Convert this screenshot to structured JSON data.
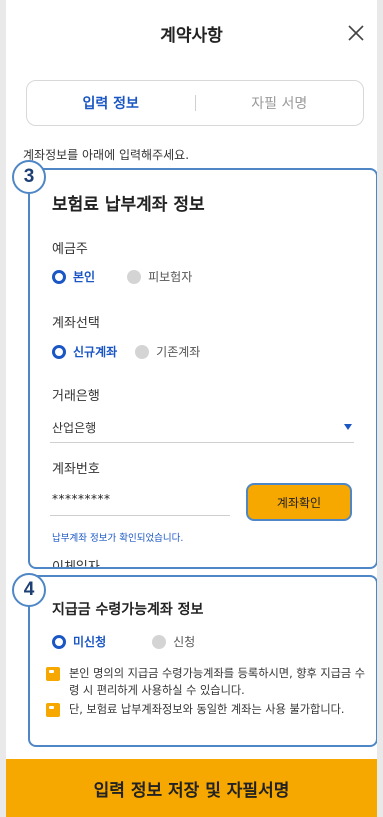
{
  "header": {
    "title": "계약사항"
  },
  "tabs": [
    {
      "label": "입력 정보",
      "active": true
    },
    {
      "label": "자필 서명",
      "active": false
    }
  ],
  "intro": "계좌정보를 아래에 입력해주세요.",
  "section1": {
    "step": "3",
    "title": "보험료 납부계좌 정보",
    "depositor": {
      "label": "예금주",
      "options": [
        {
          "label": "본인",
          "selected": true
        },
        {
          "label": "피보험자",
          "selected": false
        }
      ]
    },
    "account_select": {
      "label": "계좌선택",
      "options": [
        {
          "label": "신규계좌",
          "selected": true
        },
        {
          "label": "기존계좌",
          "selected": false
        }
      ]
    },
    "bank": {
      "label": "거래은행",
      "value": "산업은행"
    },
    "account_number": {
      "label": "계좌번호",
      "value": "*********",
      "button": "계좌확인"
    },
    "confirm_message": "납부계좌 정보가 확인되었습니다.",
    "next_label_cut": "이체일자"
  },
  "section2": {
    "step": "4",
    "title": "지급금 수령가능계좌 정보",
    "options": [
      {
        "label": "미신청",
        "selected": true
      },
      {
        "label": "신청",
        "selected": false
      }
    ],
    "notices": [
      "본인 명의의 지급금 수령가능계좌를 등록하시면, 향후 지급금 수령 시 편리하게 사용하실 수 있습니다.",
      "단, 보험료 납부계좌정보와 동일한 계좌는 사용 불가합니다."
    ]
  },
  "bottom_button": "입력 정보 저장 및 자필서명",
  "colors": {
    "accent_blue": "#1a56c4",
    "highlight_border": "#4f87c6",
    "primary_yellow": "#f6a700"
  }
}
